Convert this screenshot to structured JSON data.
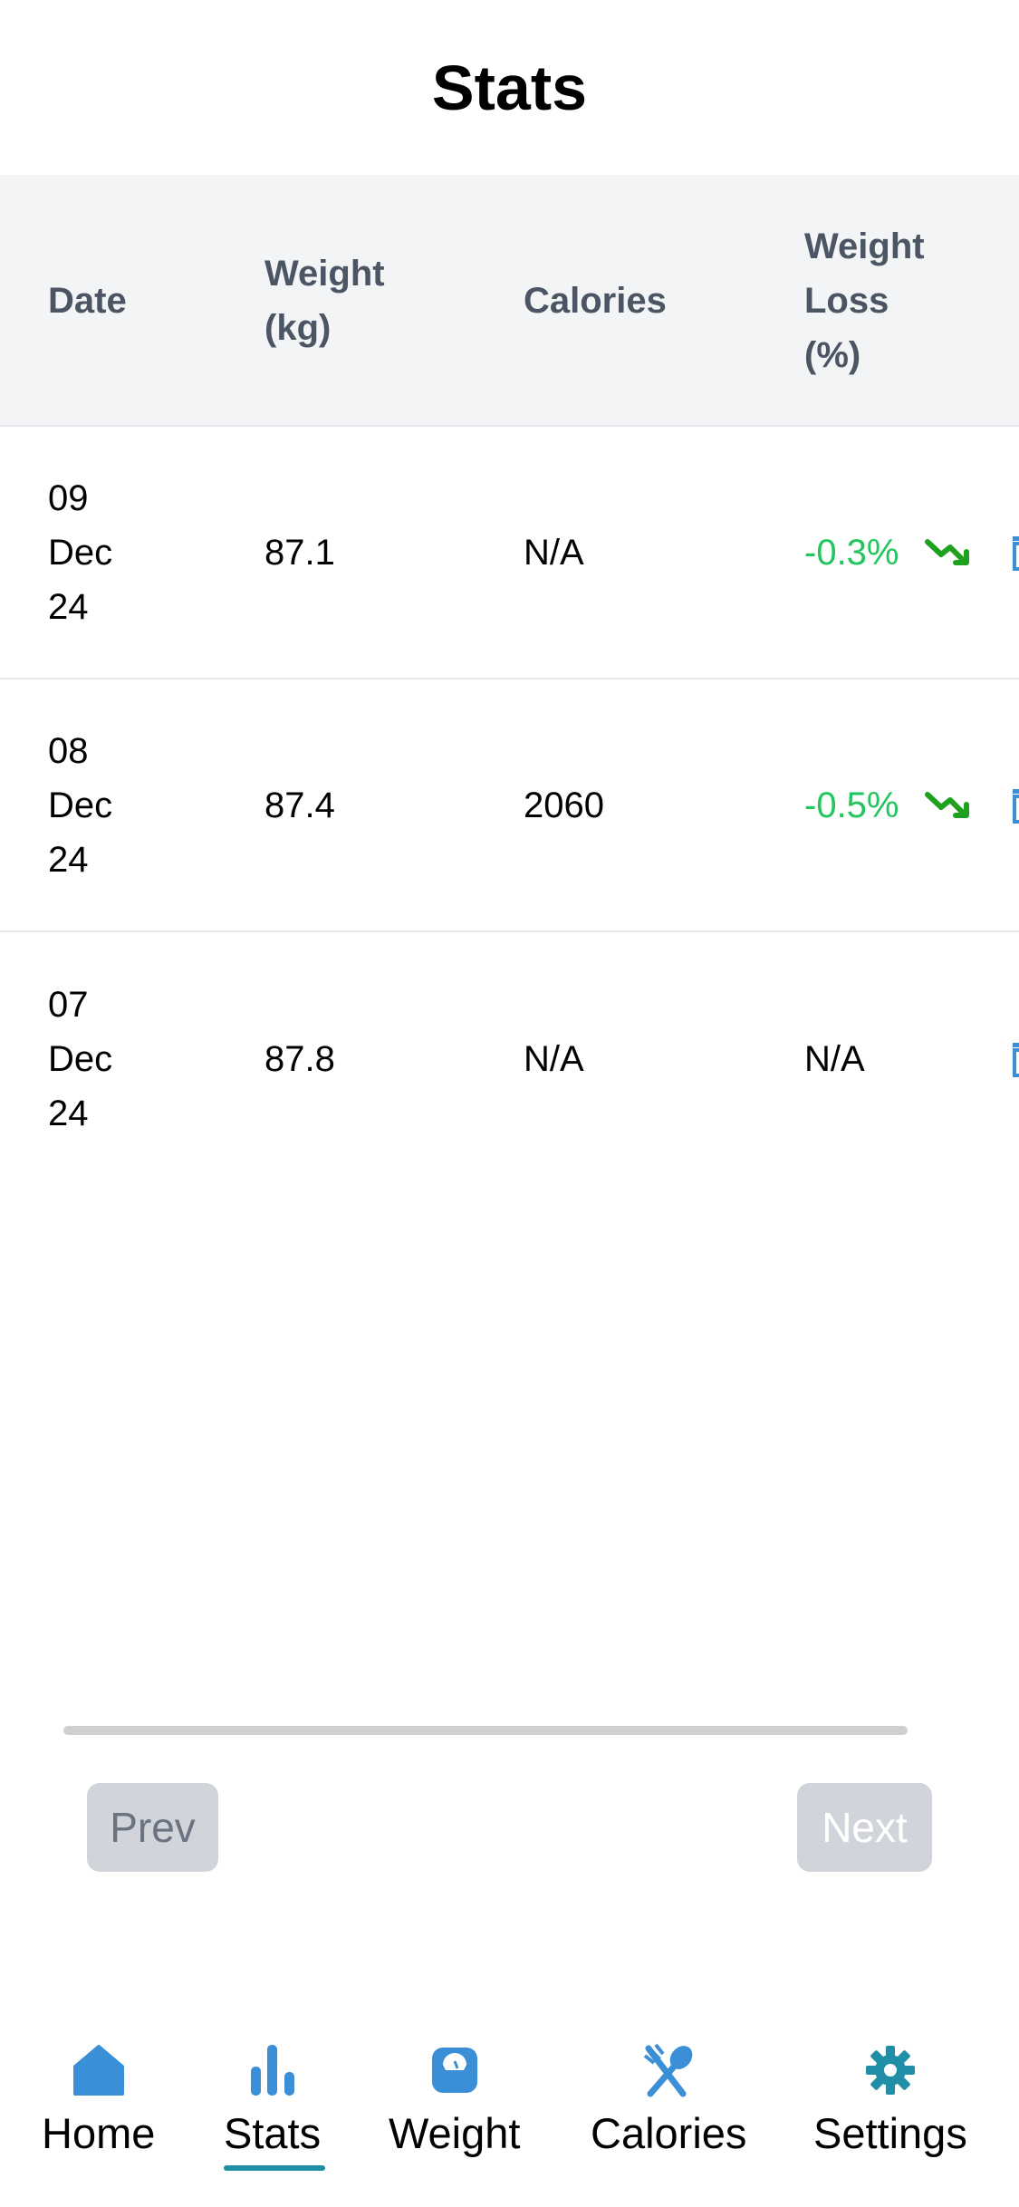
{
  "header": {
    "title": "Stats"
  },
  "table": {
    "columns": {
      "date": "Date",
      "weight": [
        "Weight",
        "(kg)"
      ],
      "calories": "Calories",
      "loss": [
        "Weight",
        "Loss",
        "(%)"
      ]
    },
    "rows": [
      {
        "date": [
          "09",
          "Dec",
          "24"
        ],
        "weight": "87.1",
        "calories": "N/A",
        "loss": "-0.3%",
        "trend": "trending-down"
      },
      {
        "date": [
          "08",
          "Dec",
          "24"
        ],
        "weight": "87.4",
        "calories": "2060",
        "loss": "-0.5%",
        "trend": "trending-down"
      },
      {
        "date": [
          "07",
          "Dec",
          "24"
        ],
        "weight": "87.8",
        "calories": "N/A",
        "loss": "N/A",
        "trend": "none"
      }
    ]
  },
  "pagination": {
    "prev_label": "Prev",
    "next_label": "Next"
  },
  "tabs": [
    {
      "label": "Home",
      "icon": "home-icon"
    },
    {
      "label": "Stats",
      "icon": "bar-chart-icon",
      "active": true
    },
    {
      "label": "Weight",
      "icon": "scale-icon"
    },
    {
      "label": "Calories",
      "icon": "utensils-icon"
    },
    {
      "label": "Settings",
      "icon": "gear-icon"
    }
  ],
  "colors": {
    "accent": "#1f8ea6",
    "tab_icon": "#3b8fd6",
    "loss_green": "#22c55e",
    "trend_green": "#1fa01f",
    "header_bg": "#f3f4f6",
    "button_disabled": "#d1d5db"
  }
}
